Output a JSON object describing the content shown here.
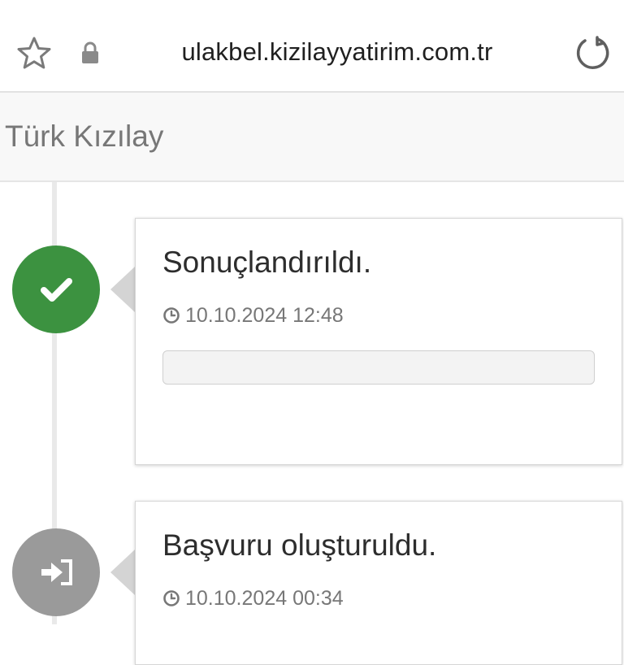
{
  "browser": {
    "url": "ulakbel.kizilayyatirim.com.tr",
    "icons": {
      "bookmark": "star-icon",
      "secure": "lock-icon",
      "reload": "reload-icon"
    }
  },
  "site": {
    "title": "Türk Kızılay"
  },
  "timeline": {
    "events": [
      {
        "title": "Sonuçlandırıldı.",
        "timestamp": "10.10.2024 12:48",
        "icon": "check-icon",
        "color": "#3c9240",
        "notes": ""
      },
      {
        "title": "Başvuru oluşturuldu.",
        "timestamp": "10.10.2024 00:34",
        "icon": "sign-in-icon",
        "color": "#9a9a9a"
      }
    ]
  }
}
